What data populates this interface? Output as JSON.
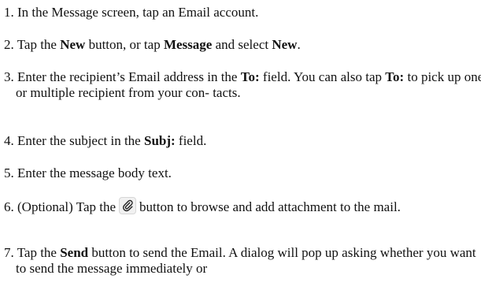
{
  "steps": [
    {
      "number": "1.",
      "text": "In the Message screen, tap an Email account."
    },
    {
      "number": "2.",
      "pre": "Tap the ",
      "bold1": "New",
      "mid": " button, or tap ",
      "bold2": "Message",
      "mid2": " and select ",
      "bold3": "New",
      "post": "."
    },
    {
      "number": "3.",
      "pre": "Enter the recipient’s Email address in the ",
      "bold1": "To:",
      "mid": " field. You can also tap ",
      "bold2": "To:",
      "post": " to pick up one or multiple recipient from your con- tacts."
    },
    {
      "number": "4.",
      "pre": "Enter the subject in the ",
      "bold1": "Subj:",
      "post": " field."
    },
    {
      "number": "5.",
      "text": "Enter the message body text."
    },
    {
      "number": "6.",
      "pre": "(Optional) Tap the",
      "icon": "paperclip-icon",
      "post": "button to browse and add attachment to the mail."
    },
    {
      "number": "7.",
      "pre": "Tap the ",
      "bold1": "Send",
      "post": " button to send the Email. A dialog will pop up asking whether you want to send the message immediately or"
    }
  ]
}
